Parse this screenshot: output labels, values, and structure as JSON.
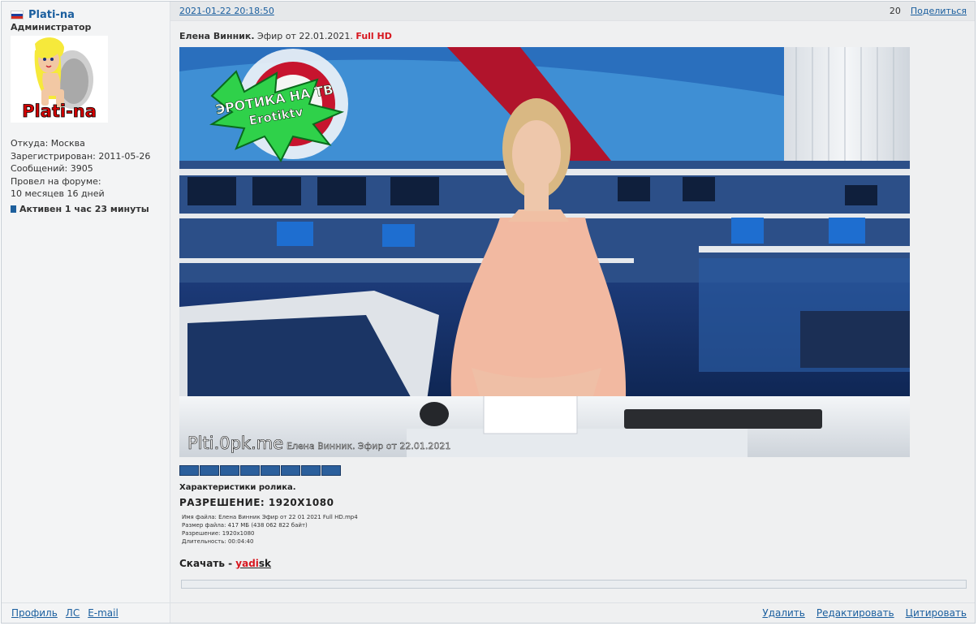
{
  "author": {
    "username": "Plati-na",
    "rank": "Администратор",
    "avatar_text": "Plati-na",
    "location": "Откуда: Москва",
    "registered": "Зарегистрирован: 2011-05-26",
    "posts": "Сообщений: 3905",
    "forum_time_label": "Провел на форуме:",
    "forum_time_value": "10 месяцев 16 дней",
    "active": "Активен 1 час 23 минуты",
    "flag_icon": "russia-flag-icon"
  },
  "post": {
    "date": "2021-01-22 20:18:50",
    "number": "20",
    "share_label": "Поделиться",
    "title_bold": "Елена Винник.",
    "title_text": "Эфир от 22.01.2021.",
    "title_quality": "Full HD",
    "image": {
      "logo_line1": "ЭРОТИКА НА ТВ",
      "logo_line2": "Erotiktv",
      "watermark_site": "Plti.0pk.me",
      "watermark_caption": "Елена Винник. Эфир от 22.01.2021"
    },
    "characteristics_title": "Характеристики ролика.",
    "resolution_line": "РАЗРЕШЕНИЕ: 1920X1080",
    "file_info": {
      "name": "Имя файла: Елена Винник Эфир от 22 01 2021 Full HD.mp4",
      "size": "Размер файла: 417 МБ (438 062 822 байт)",
      "resolution": "Разрешение: 1920x1080",
      "duration": "Длительность: 00:04:40"
    },
    "download_label": "Скачать -",
    "download_link_red": "yadi",
    "download_link_dark": "sk"
  },
  "footer": {
    "profile": "Профиль",
    "pm": "ЛС",
    "email": "E-mail",
    "delete": "Удалить",
    "edit": "Редактировать",
    "quote": "Цитировать"
  },
  "colors": {
    "link": "#1a5e9e",
    "accent_red": "#d7171f",
    "background": "#f3f4f5"
  }
}
